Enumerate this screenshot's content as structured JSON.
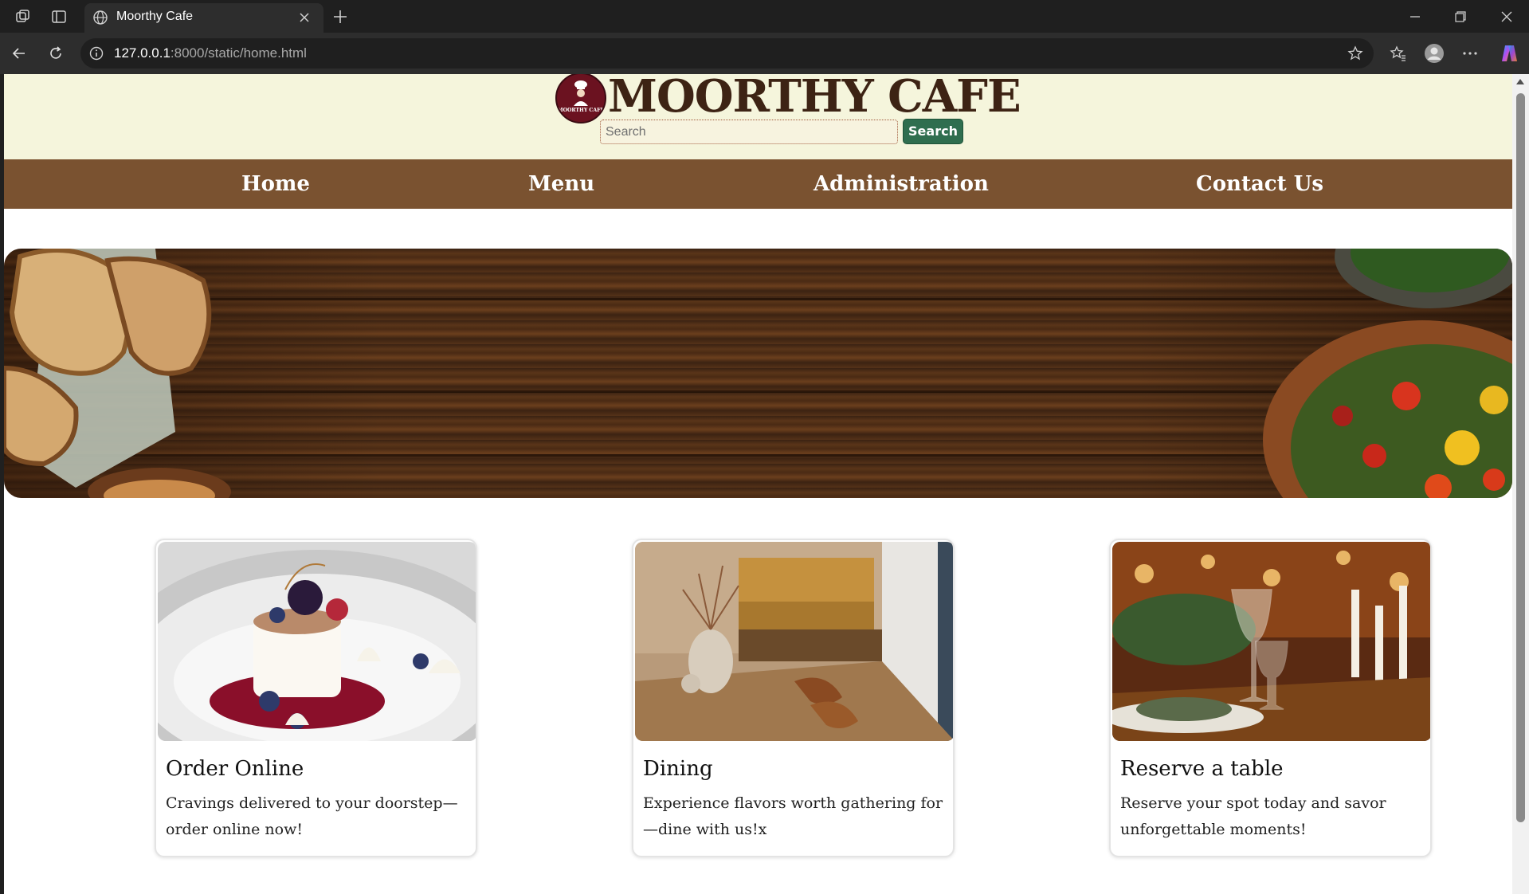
{
  "browser": {
    "tab_title": "Moorthy Cafe",
    "url_host": "127.0.0.1",
    "url_rest": ":8000/static/home.html"
  },
  "site": {
    "title": "MOORTHY CAFE",
    "logo_text": "MOORTHY CAFE",
    "search_placeholder": "Search",
    "search_button": "Search"
  },
  "nav": {
    "home": "Home",
    "menu": "Menu",
    "administration": "Administration",
    "contact": "Contact Us"
  },
  "cards": [
    {
      "title": "Order Online",
      "text": "Cravings delivered to your doorstep—order online now!"
    },
    {
      "title": "Dining",
      "text": "Experience flavors worth gathering for—dine with us!x"
    },
    {
      "title": "Reserve a table",
      "text": "Reserve your spot today and savor unforgettable moments!"
    }
  ],
  "colors": {
    "header_bg": "#f5f5dc",
    "nav_bg": "#7a5230",
    "search_button_bg": "#2f6e4f",
    "title_color": "#3d2314"
  }
}
